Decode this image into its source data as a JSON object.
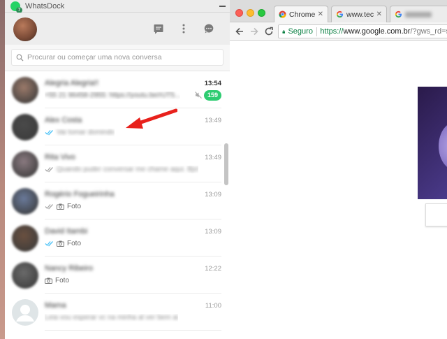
{
  "whatsdock": {
    "window_title": "WhatsDock",
    "app_badge_count": "7",
    "search_placeholder": "Procurar ou começar uma nova conversa",
    "chats": [
      {
        "name": "Alegria Alegria!!",
        "time": "13:54",
        "time_bold": true,
        "preview": "+55 21 96458-2955: https://youtu.be/rUT5...",
        "ticks": "none",
        "media": "",
        "unread": "159",
        "muted": true,
        "avatar_color": "#9b7a6a"
      },
      {
        "name": "Alex Costa",
        "time": "13:49",
        "preview": "Vai tomar domindo",
        "ticks": "blue",
        "media": "",
        "avatar_color": "#4a4a4a"
      },
      {
        "name": "Rita Vivo",
        "time": "13:49",
        "preview": "Quando puder conversar me chame aqui. Bjs!",
        "ticks": "gray",
        "media": "",
        "avatar_color": "#8a7a80"
      },
      {
        "name": "Rogério Fogueirinha",
        "time": "13:09",
        "preview": "Foto",
        "ticks": "gray",
        "media": "camera",
        "avatar_color": "#6a7a9a"
      },
      {
        "name": "David Itambi",
        "time": "13:09",
        "preview": "Foto",
        "ticks": "blue",
        "media": "camera",
        "avatar_color": "#6a5040"
      },
      {
        "name": "Nancy Ribeiro",
        "time": "12:22",
        "preview": "Foto",
        "ticks": "none",
        "media": "camera",
        "avatar_color": "#6a6a6a"
      },
      {
        "name": "Mama",
        "time": "11:00",
        "preview": "Leia vou esperar vc na minha al ver bem ai",
        "ticks": "none",
        "media": "",
        "avatar_color": "default"
      }
    ]
  },
  "chrome": {
    "tabs": [
      {
        "title": "Chrome W",
        "icon": "chrome-icon"
      },
      {
        "title": "www.techt",
        "icon": "google-icon"
      },
      {
        "title": "",
        "icon": "google-icon",
        "blurred": true
      }
    ],
    "omnibox": {
      "secure_label": "Seguro",
      "scheme": "https://",
      "host": "www.google.com.br",
      "path": "/?gws_rd=s"
    }
  },
  "colors": {
    "whatsapp_green": "#25d366",
    "unread_green": "#2ecc71",
    "blue_tick": "#4fc3f7",
    "arrow_red": "#e8211c"
  }
}
